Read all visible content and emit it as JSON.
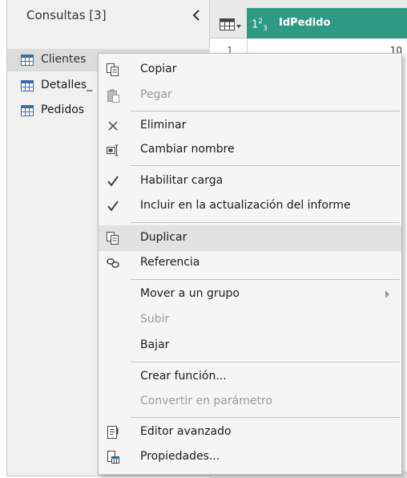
{
  "queries": {
    "title": "Consultas [3]",
    "items": [
      {
        "label": "Clientes"
      },
      {
        "label": "Detalles_"
      },
      {
        "label": "Pedidos"
      }
    ]
  },
  "grid": {
    "column": {
      "type_base": "1",
      "type_sup": "2",
      "type_sub": "3",
      "name": "IdPedido"
    },
    "rows": [
      {
        "number": "1",
        "value": "10"
      }
    ]
  },
  "menu": {
    "copy": "Copiar",
    "paste": "Pegar",
    "delete": "Eliminar",
    "rename": "Cambiar nombre",
    "enable_load": "Habilitar carga",
    "include_refresh": "Incluir en la actualización del informe",
    "duplicate": "Duplicar",
    "reference": "Referencia",
    "move_group": "Mover a un grupo",
    "move_up": "Subir",
    "move_down": "Bajar",
    "create_function": "Crear función...",
    "convert_parameter": "Convertir en parámetro",
    "advanced_editor": "Editor avanzado",
    "properties": "Propiedades..."
  },
  "icons": {
    "copy": "copy-icon",
    "paste": "paste-icon",
    "delete": "close-icon",
    "rename": "rename-icon",
    "enable_load": "checkmark-icon",
    "include_refresh": "checkmark-icon",
    "duplicate": "duplicate-icon",
    "reference": "reference-icon",
    "advanced_editor": "advanced-editor-icon",
    "properties": "properties-icon",
    "table": "table-icon"
  },
  "colors": {
    "column_header": "#2f9a84",
    "selected_query": "#dcdcdc",
    "menu_hover": "#e2e2e2",
    "menu_background": "#f5f5f5",
    "disabled_text": "#9a9a9a"
  }
}
